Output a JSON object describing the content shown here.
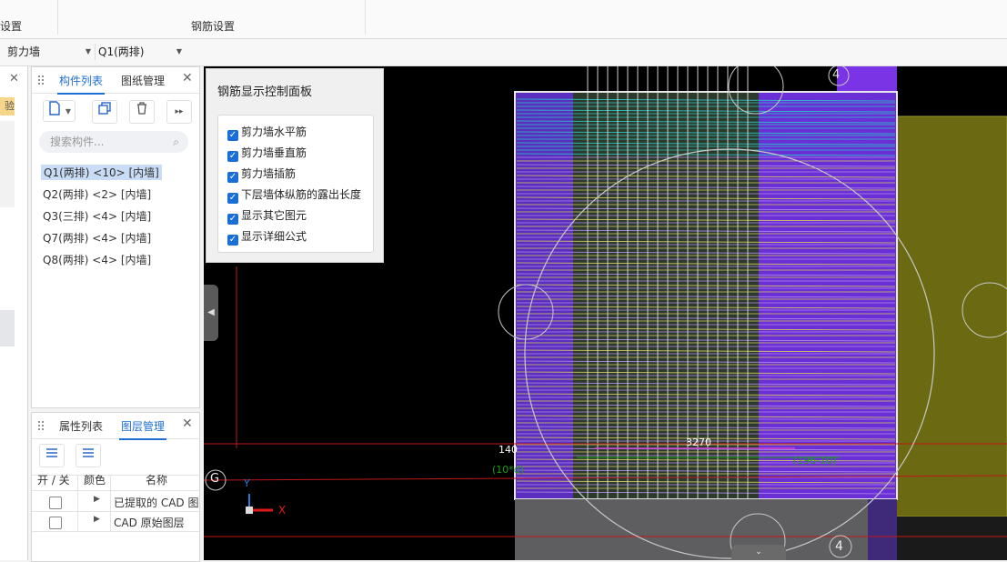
{
  "ribbon": {
    "left_group": "设置",
    "rebar_group": "钢筋设置"
  },
  "toolbar": {
    "type_value": "剪力墙",
    "component_value": "Q1(两排)"
  },
  "left_edge": {
    "badge": "验",
    "close": "✕"
  },
  "component_panel": {
    "tabs": [
      "构件列表",
      "图纸管理"
    ],
    "close": "✕",
    "search_placeholder": "搜索构件...",
    "items": [
      "Q1(两排) <10> [内墙]",
      "Q2(两排) <2> [内墙]",
      "Q3(三排) <4> [内墙]",
      "Q7(两排) <4> [内墙]",
      "Q8(两排) <4> [内墙]"
    ]
  },
  "layer_panel": {
    "tabs": [
      "属性列表",
      "图层管理"
    ],
    "close": "✕",
    "headers": [
      "开 / 关",
      "颜色",
      "名称"
    ],
    "rows": [
      "已提取的 CAD 图",
      "CAD 原始图层"
    ]
  },
  "control_panel": {
    "title": "钢筋显示控制面板",
    "options": [
      "剪力墙水平筋",
      "剪力墙垂直筋",
      "剪力墙插筋",
      "下层墙体纵筋的露出长度",
      "显示其它图元",
      "显示详细公式"
    ]
  },
  "canvas": {
    "axis_top": "4",
    "axis_bottom": "4",
    "axis_left": "G",
    "dim_140": "140",
    "dim_3270": "3270",
    "label_10d": "(10*d)",
    "label_196": "(196-10)",
    "axis_x": "X",
    "axis_y": "Y"
  }
}
